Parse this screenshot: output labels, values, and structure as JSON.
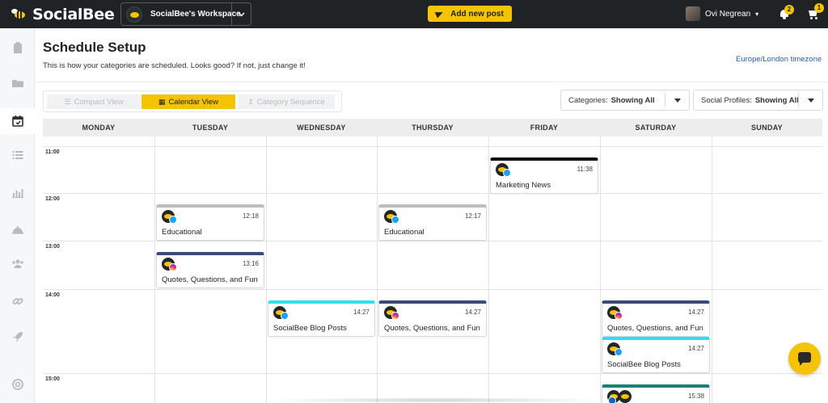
{
  "app": {
    "name": "SocialBee"
  },
  "topbar": {
    "workspace": "SocialBee's Workspace",
    "add_post_label": "Add new post",
    "user_name": "Ovi Negrean",
    "notifications_count": "2",
    "cart_count": "1"
  },
  "sidebar": {
    "items": [
      {
        "icon": "clipboard-icon"
      },
      {
        "icon": "folder-icon"
      },
      {
        "icon": "calendar-icon",
        "active": true
      },
      {
        "icon": "list-icon"
      },
      {
        "icon": "analytics-icon"
      },
      {
        "icon": "cloche-icon"
      },
      {
        "icon": "users-icon"
      },
      {
        "icon": "link-icon"
      },
      {
        "icon": "rocket-icon"
      },
      {
        "icon": "help-icon"
      }
    ]
  },
  "header": {
    "title": "Schedule Setup",
    "subtitle": "This is how your categories are scheduled. Looks good? If not, just change it!",
    "timezone": "Europe/London timezone"
  },
  "views": {
    "compact": "Compact View",
    "calendar": "Calendar View",
    "sequence": "Category Sequence",
    "active": "calendar"
  },
  "filters": {
    "categories_label": "Categories:",
    "categories_value": "Showing All",
    "profiles_label": "Social Profiles:",
    "profiles_value": "Showing All"
  },
  "calendar": {
    "days": [
      "MONDAY",
      "TUESDAY",
      "WEDNESDAY",
      "THURSDAY",
      "FRIDAY",
      "SATURDAY",
      "SUNDAY"
    ],
    "time_slots": [
      "11:00",
      "12:00",
      "13:00",
      "14:00",
      "15:00"
    ],
    "posts": [
      {
        "day": "FRIDAY",
        "time": "11:38",
        "title": "Marketing News",
        "network": "twitter",
        "color": "#111111"
      },
      {
        "day": "TUESDAY",
        "time": "12:18",
        "title": "Educational",
        "network": "twitter",
        "color": "#bdbdbd"
      },
      {
        "day": "THURSDAY",
        "time": "12:17",
        "title": "Educational",
        "network": "twitter",
        "color": "#bdbdbd"
      },
      {
        "day": "TUESDAY",
        "time": "13:16",
        "title": "Quotes, Questions, and Fun",
        "network": "instagram",
        "color": "#3b4a7a"
      },
      {
        "day": "WEDNESDAY",
        "time": "14:27",
        "title": "SocialBee Blog Posts",
        "network": "twitter",
        "color": "#2fe0e6"
      },
      {
        "day": "THURSDAY",
        "time": "14:27",
        "title": "Quotes, Questions, and Fun",
        "network": "instagram",
        "color": "#3b4a7a"
      },
      {
        "day": "SATURDAY",
        "time": "14:27",
        "title": "Quotes, Questions, and Fun",
        "network": "instagram",
        "color": "#3b4a7a"
      },
      {
        "day": "SATURDAY",
        "time": "14:27",
        "title": "SocialBee Blog Posts",
        "network": "twitter",
        "color": "#2fe0e6"
      },
      {
        "day": "SATURDAY",
        "time": "15:38",
        "title": "",
        "network": "linkedin",
        "color": "#1d7f74"
      }
    ]
  }
}
